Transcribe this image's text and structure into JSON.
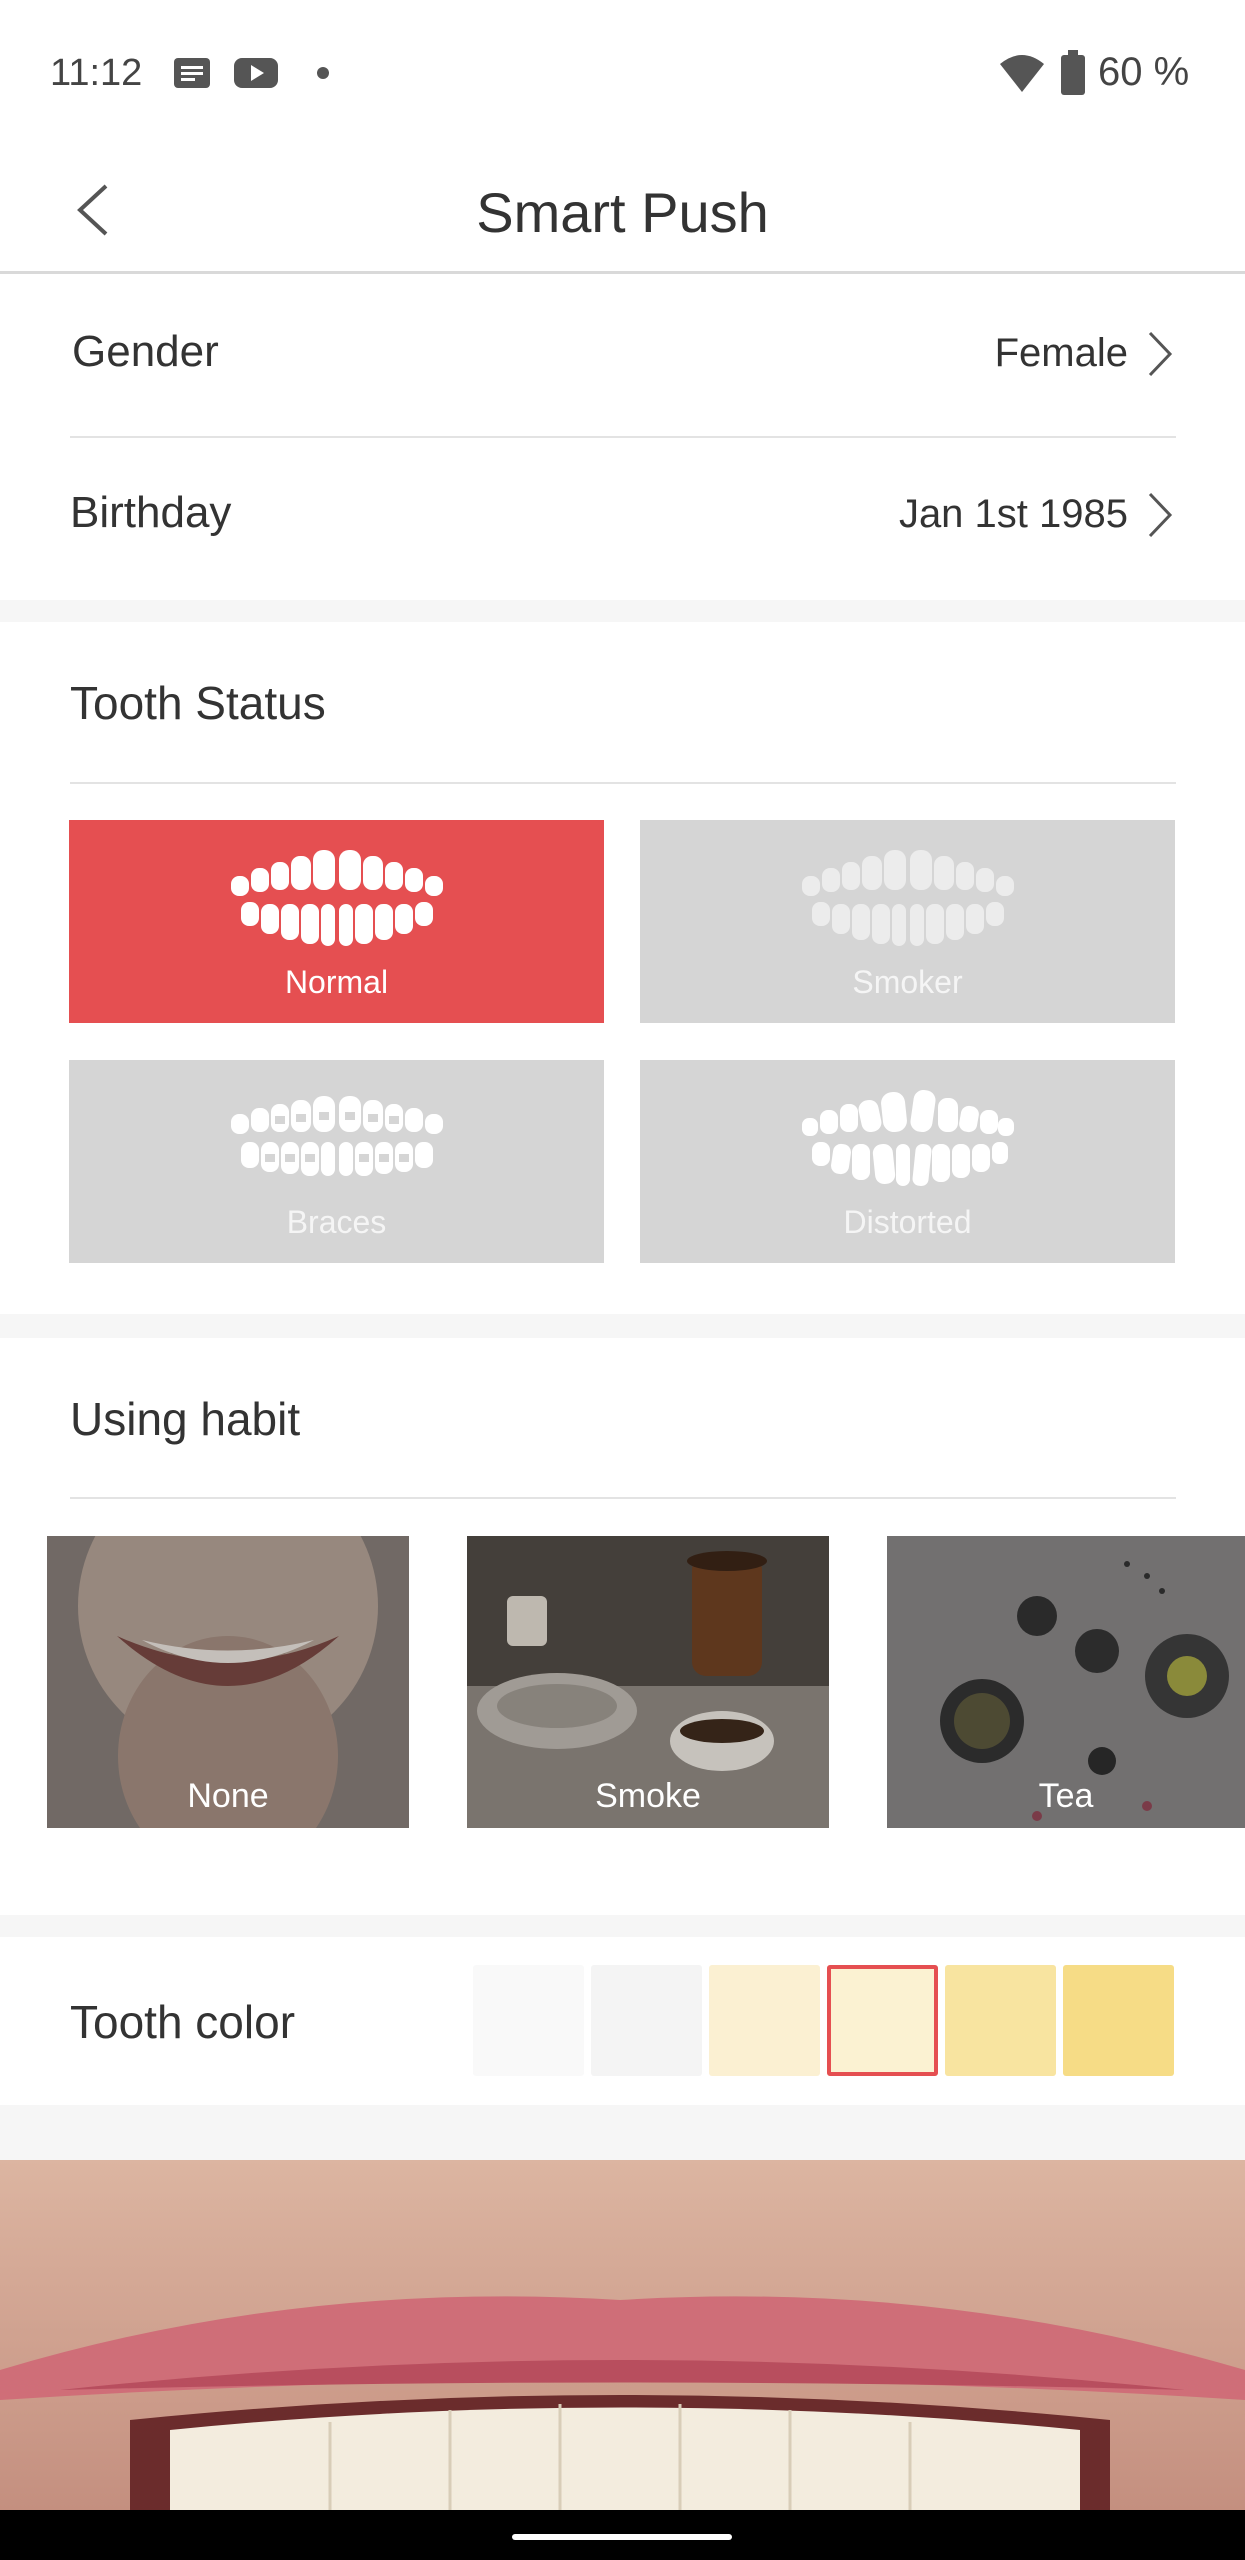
{
  "status_bar": {
    "time": "11:12",
    "battery": "60 %",
    "icons": [
      "message-icon",
      "youtube-icon",
      "dot-icon",
      "wifi-icon",
      "battery-icon"
    ]
  },
  "header": {
    "title": "Smart Push",
    "back_icon": "chevron-left-icon"
  },
  "profile": {
    "gender_label": "Gender",
    "gender_value": "Female",
    "birthday_label": "Birthday",
    "birthday_value": "Jan 1st 1985"
  },
  "tooth_status": {
    "title": "Tooth Status",
    "options": [
      {
        "label": "Normal",
        "selected": true
      },
      {
        "label": "Smoker",
        "selected": false
      },
      {
        "label": "Braces",
        "selected": false
      },
      {
        "label": "Distorted",
        "selected": false
      }
    ]
  },
  "using_habit": {
    "title": "Using habit",
    "options": [
      {
        "label": "None"
      },
      {
        "label": "Smoke"
      },
      {
        "label": "Tea"
      }
    ]
  },
  "tooth_color": {
    "label": "Tooth color",
    "swatches": [
      "#f9f9f9",
      "#f4f4f4",
      "#fbf0d2",
      "#fbf2d2",
      "#f8e4a0",
      "#f6dc86"
    ],
    "selected_index": 3
  },
  "colors": {
    "accent": "#e54f51",
    "tile_inactive": "#d5d5d5"
  }
}
